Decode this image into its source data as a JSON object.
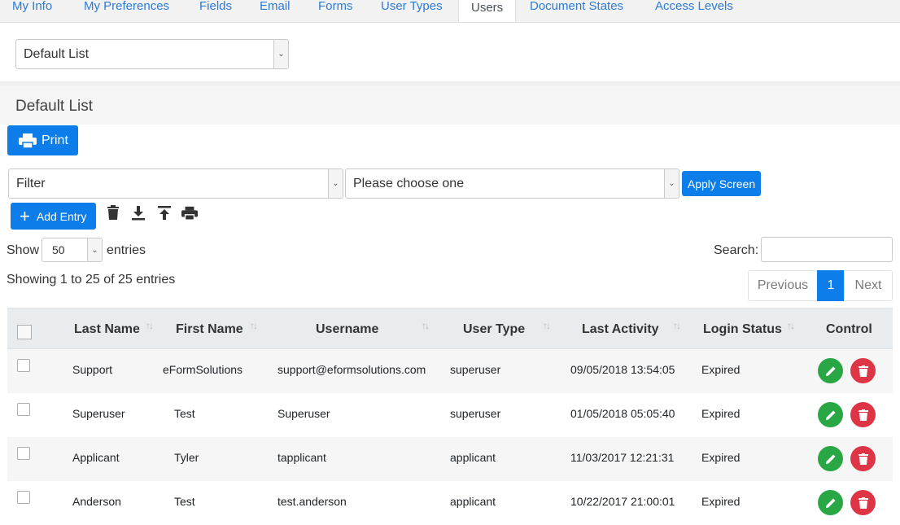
{
  "tabs": [
    "My Info",
    "My Preferences",
    "Fields",
    "Email",
    "Forms",
    "User Types",
    "Users",
    "Document States",
    "Access Levels"
  ],
  "list_select": {
    "value": "Default List"
  },
  "section_title": "Default List",
  "print_label": "Print",
  "filter_select": {
    "value": "Filter"
  },
  "screen_select": {
    "value": "Please choose one"
  },
  "apply_label": "Apply Screen",
  "add_label": "Add Entry",
  "length": {
    "show": "Show",
    "value": "50",
    "entries": "entries"
  },
  "search_label": "Search:",
  "info": "Showing 1 to 25 of 25 entries",
  "pagination": {
    "prev": "Previous",
    "page": "1",
    "next": "Next"
  },
  "columns": [
    "Last Name",
    "First Name",
    "Username",
    "User Type",
    "Last Activity",
    "Login Status",
    "Control"
  ],
  "rows": [
    {
      "last": "Support",
      "first": "eFormSolutions",
      "username": "support@eformsolutions.com",
      "type": "superuser",
      "activity": "09/05/2018 13:54:05",
      "status": "Expired"
    },
    {
      "last": "Superuser",
      "first": "Test",
      "username": "Superuser",
      "type": "superuser",
      "activity": "01/05/2018 05:05:40",
      "status": "Expired"
    },
    {
      "last": "Applicant",
      "first": "Tyler",
      "username": "tapplicant",
      "type": "applicant",
      "activity": "11/03/2017 12:21:31",
      "status": "Expired"
    },
    {
      "last": "Anderson",
      "first": "Test",
      "username": "test.anderson",
      "type": "applicant",
      "activity": "10/22/2017 21:00:01",
      "status": "Expired"
    }
  ],
  "colors": {
    "primary": "#0d7dea",
    "edit": "#2aa745",
    "delete": "#dd3545",
    "link": "#2c7bd6"
  }
}
